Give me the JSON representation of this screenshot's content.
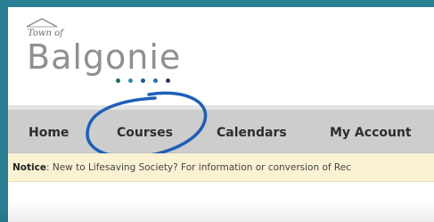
{
  "logo": {
    "small_text": "Town of",
    "big_text": "Balgonie",
    "dot_colors": [
      "#1f6f5c",
      "#2e8bb0",
      "#1f5a8a",
      "#2a6fa8",
      "#2d3a5a"
    ]
  },
  "nav": {
    "items": [
      {
        "label": "Home"
      },
      {
        "label": "Courses"
      },
      {
        "label": "Calendars"
      },
      {
        "label": "My Account"
      }
    ],
    "highlighted": "Courses"
  },
  "notice": {
    "label": "Notice",
    "text": ": New to Lifesaving Society? For information or conversion of Rec"
  },
  "colors": {
    "frame": "#2a7f95",
    "nav_bg": "#cdcdcd",
    "notice_bg": "#fbf2d3",
    "highlight_circle": "#1f5fb8"
  }
}
